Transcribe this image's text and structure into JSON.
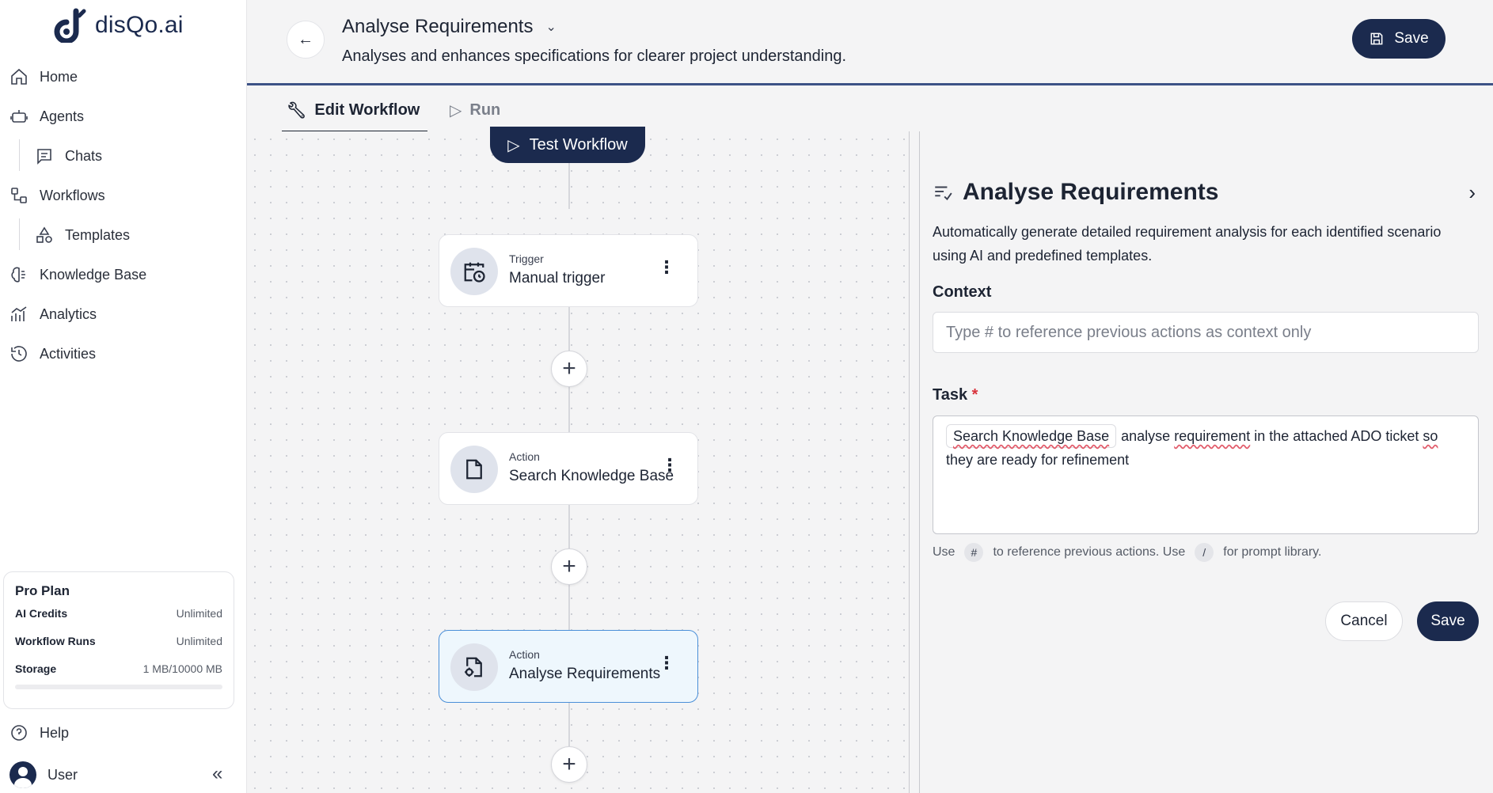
{
  "brand": {
    "name": "disQo.ai",
    "color": "#1b2a4e"
  },
  "sidebar": {
    "items": [
      {
        "label": "Home",
        "icon": "home-icon"
      },
      {
        "label": "Agents",
        "icon": "bot-icon"
      },
      {
        "label": "Chats",
        "icon": "chat-icon"
      },
      {
        "label": "Workflows",
        "icon": "workflow-icon"
      },
      {
        "label": "Templates",
        "icon": "shapes-icon"
      },
      {
        "label": "Knowledge Base",
        "icon": "brain-icon"
      },
      {
        "label": "Analytics",
        "icon": "chart-icon"
      },
      {
        "label": "Activities",
        "icon": "history-icon"
      }
    ],
    "plan": {
      "title": "Pro Plan",
      "rows": [
        {
          "key": "AI Credits",
          "value": "Unlimited"
        },
        {
          "key": "Workflow Runs",
          "value": "Unlimited"
        },
        {
          "key": "Storage",
          "value": "1 MB/10000 MB"
        }
      ],
      "storage_fraction": 0.0001
    },
    "help_label": "Help",
    "user_label": "User"
  },
  "header": {
    "title": "Analyse Requirements",
    "subtitle": "Analyses and enhances specifications for clearer project understanding.",
    "save_label": "Save"
  },
  "tabs": [
    {
      "label": "Edit Workflow",
      "active": true
    },
    {
      "label": "Run",
      "active": false
    }
  ],
  "canvas": {
    "test_label": "Test Workflow",
    "nodes": [
      {
        "kind": "Trigger",
        "name": "Manual trigger",
        "icon": "calendar-clock-icon"
      },
      {
        "kind": "Action",
        "name": "Search Knowledge Base",
        "icon": "file-icon"
      },
      {
        "kind": "Action",
        "name": "Analyse Requirements",
        "icon": "file-cog-icon"
      }
    ]
  },
  "panel": {
    "title": "Analyse Requirements",
    "description": "Automatically generate detailed requirement analysis for each identified scenario using AI and predefined templates.",
    "context_label": "Context",
    "context_placeholder": "Type # to reference previous actions as context only",
    "task_label": "Task",
    "task_required": "*",
    "task_chip": "Search Knowledge Base",
    "task_text_1": "analyse",
    "task_text_2": "requirement",
    "task_text_3": "in the attached ADO ticket",
    "task_text_4": "so",
    "task_text_5": "they are ready for refinement",
    "hint_1": "Use",
    "hint_key_1": "#",
    "hint_2": "to reference previous actions. Use",
    "hint_key_2": "/",
    "hint_3": "for prompt library.",
    "cancel_label": "Cancel",
    "save_label": "Save"
  }
}
